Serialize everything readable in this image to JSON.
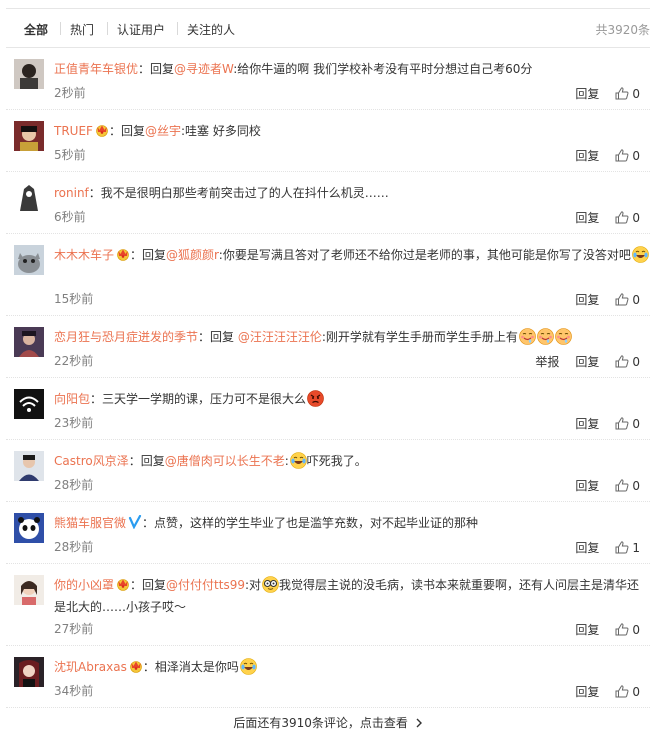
{
  "tabs": [
    "全部",
    "热门",
    "认证用户",
    "关注的人"
  ],
  "total": "共3920条",
  "reply_label": "回复",
  "report_label": "举报",
  "comments": [
    {
      "user": "正值青年车银优",
      "badge": "",
      "parts": [
        {
          "t": "text",
          "v": "："
        },
        {
          "t": "text",
          "v": "回复"
        },
        {
          "t": "mention",
          "v": "@寻迹者W"
        },
        {
          "t": "text",
          "v": ":给你牛逼的啊 我们学校补考没有平时分想过自己考60分"
        }
      ],
      "time": "2秒前",
      "likes": "0"
    },
    {
      "user": "TRUEF",
      "badge": "crown",
      "parts": [
        {
          "t": "text",
          "v": "："
        },
        {
          "t": "text",
          "v": "回复"
        },
        {
          "t": "mention",
          "v": "@丝宇"
        },
        {
          "t": "text",
          "v": ":哇塞 好多同校"
        }
      ],
      "time": "5秒前",
      "likes": "0"
    },
    {
      "user": "roninf",
      "badge": "",
      "parts": [
        {
          "t": "text",
          "v": "："
        },
        {
          "t": "text",
          "v": "我不是很明白那些考前突击过了的人在抖什么机灵……"
        }
      ],
      "time": "6秒前",
      "likes": "0"
    },
    {
      "user": "木木木车子",
      "badge": "crown",
      "parts": [
        {
          "t": "text",
          "v": "："
        },
        {
          "t": "text",
          "v": "回复"
        },
        {
          "t": "mention",
          "v": "@狐颜颜r"
        },
        {
          "t": "text",
          "v": ":你要是写满且答对了老师还不给你过是老师的事，其他可能是你写了没答对吧"
        },
        {
          "t": "emoji",
          "v": "laugh-cry"
        }
      ],
      "time": "15秒前",
      "likes": "0"
    },
    {
      "user": "恋月狂与恐月症迸发的季节",
      "badge": "",
      "parts": [
        {
          "t": "text",
          "v": "："
        },
        {
          "t": "text",
          "v": "回复 "
        },
        {
          "t": "mention",
          "v": "@汪汪汪汪汪伦"
        },
        {
          "t": "text",
          "v": ":刚开学就有学生手册而学生手册上有"
        },
        {
          "t": "emoji",
          "v": "drool"
        },
        {
          "t": "emoji",
          "v": "drool"
        },
        {
          "t": "emoji",
          "v": "drool"
        }
      ],
      "time": "22秒前",
      "likes": "0",
      "report": true
    },
    {
      "user": "向阳包",
      "badge": "",
      "parts": [
        {
          "t": "text",
          "v": "："
        },
        {
          "t": "text",
          "v": "三天学一学期的课，压力可不是很大么"
        },
        {
          "t": "emoji",
          "v": "angry"
        }
      ],
      "time": "23秒前",
      "likes": "0"
    },
    {
      "user": "Castro风京泽",
      "badge": "",
      "parts": [
        {
          "t": "text",
          "v": "："
        },
        {
          "t": "text",
          "v": "回复"
        },
        {
          "t": "mention",
          "v": "@唐僧肉可以长生不老"
        },
        {
          "t": "text",
          "v": ":"
        },
        {
          "t": "emoji",
          "v": "laugh-cry"
        },
        {
          "t": "text",
          "v": "吓死我了。"
        }
      ],
      "time": "28秒前",
      "likes": "0"
    },
    {
      "user": "熊猫车服官微",
      "badge": "verified",
      "parts": [
        {
          "t": "text",
          "v": "："
        },
        {
          "t": "text",
          "v": "点赞，这样的学生毕业了也是滥竽充数，对不起毕业证的那种"
        }
      ],
      "time": "28秒前",
      "likes": "1"
    },
    {
      "user": "你的小凶罩",
      "badge": "crown",
      "parts": [
        {
          "t": "text",
          "v": "："
        },
        {
          "t": "text",
          "v": "回复"
        },
        {
          "t": "mention",
          "v": "@付付付tts99"
        },
        {
          "t": "text",
          "v": ":对"
        },
        {
          "t": "emoji",
          "v": "glasses"
        },
        {
          "t": "text",
          "v": "我觉得层主说的没毛病，读书本来就重要啊，还有人问层主是清华还是北大的……小孩子哎～"
        }
      ],
      "time": "27秒前",
      "likes": "0"
    },
    {
      "user": "沈玑Abraxas",
      "badge": "crown",
      "parts": [
        {
          "t": "text",
          "v": "："
        },
        {
          "t": "text",
          "v": "相泽消太是你吗"
        },
        {
          "t": "emoji",
          "v": "laugh-cry"
        }
      ],
      "time": "34秒前",
      "likes": "0"
    }
  ],
  "more_text": "后面还有3910条评论，点击查看",
  "colors": {
    "link": "#eb7350",
    "meta": "#808080",
    "verified": "#2a9cf0"
  }
}
